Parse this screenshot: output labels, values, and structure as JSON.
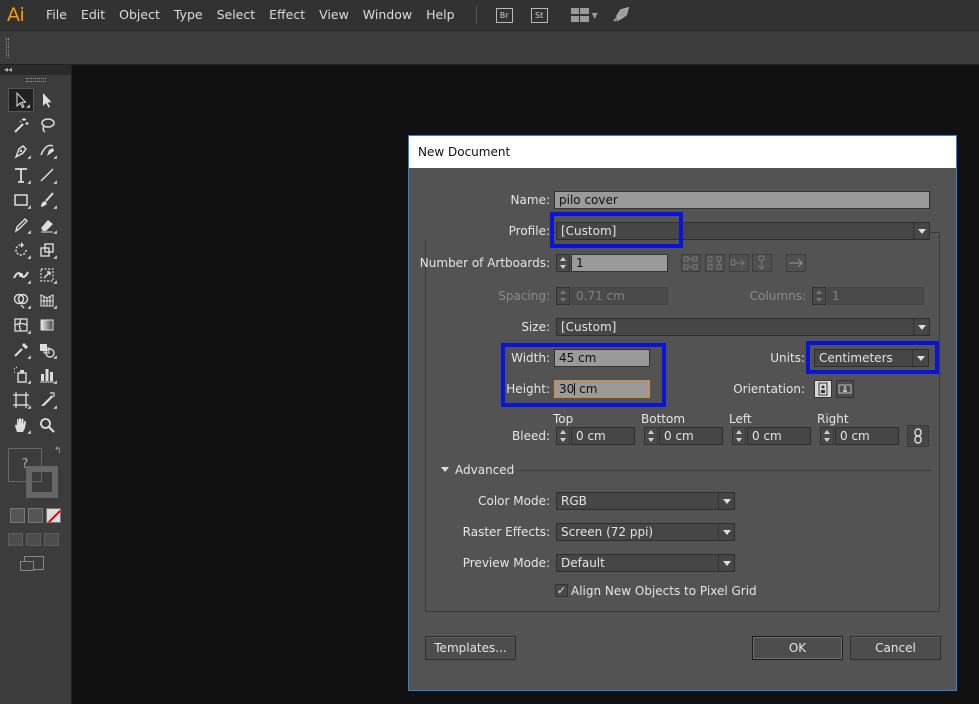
{
  "app": {
    "logo": "Ai"
  },
  "menu": [
    "File",
    "Edit",
    "Object",
    "Type",
    "Select",
    "Effect",
    "View",
    "Window",
    "Help"
  ],
  "app_buttons": {
    "bridge": "Br",
    "stock": "St"
  },
  "toolbar": {
    "collapse_label": "◂◂",
    "fill_label": "?",
    "stroke_label": "?"
  },
  "dialog": {
    "title": "New Document",
    "name": {
      "label": "Name:",
      "value": "pilo cover"
    },
    "profile": {
      "label": "Profile:",
      "value": "[Custom]"
    },
    "artboards": {
      "label": "Number of Artboards:",
      "value": "1"
    },
    "spacing": {
      "label": "Spacing:",
      "value": "0.71 cm"
    },
    "columns": {
      "label": "Columns:",
      "value": "1"
    },
    "size": {
      "label": "Size:",
      "value": "[Custom]"
    },
    "width": {
      "label": "Width:",
      "value": "45 cm"
    },
    "height": {
      "label": "Height:",
      "value_before_caret": "30",
      "value_after_caret": " cm"
    },
    "units": {
      "label": "Units:",
      "value": "Centimeters"
    },
    "orientation": {
      "label": "Orientation:"
    },
    "bleed": {
      "label": "Bleed:",
      "top": {
        "label": "Top",
        "value": "0 cm"
      },
      "bottom": {
        "label": "Bottom",
        "value": "0 cm"
      },
      "left": {
        "label": "Left",
        "value": "0 cm"
      },
      "right": {
        "label": "Right",
        "value": "0 cm"
      }
    },
    "advanced": {
      "label": "Advanced"
    },
    "color_mode": {
      "label": "Color Mode:",
      "value": "RGB"
    },
    "raster_effects": {
      "label": "Raster Effects:",
      "value": "Screen (72 ppi)"
    },
    "preview_mode": {
      "label": "Preview Mode:",
      "value": "Default"
    },
    "pixel_grid": {
      "label": "Align New Objects to Pixel Grid",
      "checked": true
    },
    "buttons": {
      "templates": "Templates...",
      "ok": "OK",
      "cancel": "Cancel"
    }
  },
  "colors": {
    "highlight": "#0a14d8",
    "focus_border": "#e08a2c",
    "dialog_bg": "#535353",
    "canvas_bg": "#111111",
    "logo": "#ff9a00"
  }
}
